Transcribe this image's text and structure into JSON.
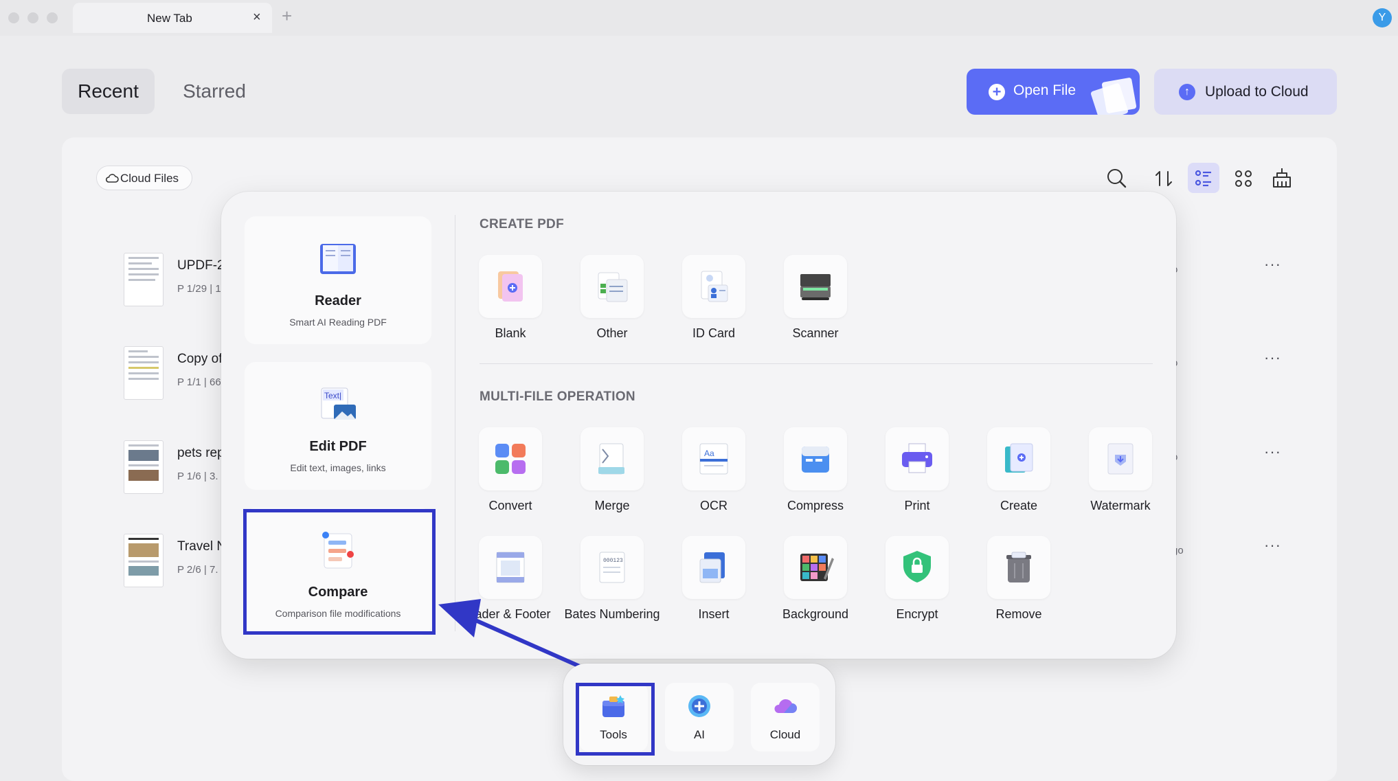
{
  "window": {
    "tab_title": "New Tab",
    "tab_close": "×",
    "new_tab": "+",
    "avatar_initial": "Y"
  },
  "header": {
    "tab_recent": "Recent",
    "tab_starred": "Starred",
    "open_file": "Open File",
    "upload": "Upload to Cloud"
  },
  "filter": {
    "cloud_files": "Cloud Files"
  },
  "files": [
    {
      "title": "UPDF-2",
      "meta": "P 1/29  |  1",
      "frag": "o"
    },
    {
      "title": "Copy of",
      "meta": "P 1/1  |  66",
      "frag": "o"
    },
    {
      "title": "pets rep",
      "meta": "P 1/6  |  3.",
      "frag": "o"
    },
    {
      "title": "Travel N",
      "meta": "P 2/6  |  7.",
      "frag": "go"
    }
  ],
  "more": "···",
  "features": [
    {
      "title": "Reader",
      "subtitle": "Smart AI Reading PDF",
      "icon": "reader-icon"
    },
    {
      "title": "Edit PDF",
      "subtitle": "Edit text, images, links",
      "icon": "edit-pdf-icon",
      "icon_text": "Text|"
    },
    {
      "title": "Compare",
      "subtitle": "Comparison file modifications",
      "icon": "compare-icon"
    }
  ],
  "create_section": {
    "heading": "CREATE PDF",
    "items": [
      "Blank",
      "Other",
      "ID Card",
      "Scanner"
    ]
  },
  "multi_section": {
    "heading": "MULTI-FILE OPERATION",
    "row1": [
      "Convert",
      "Merge",
      "OCR",
      "Compress",
      "Print",
      "Create",
      "Watermark"
    ],
    "row2": [
      "Header & Footer",
      "Bates Numbering",
      "Insert",
      "Background",
      "Encrypt",
      "Remove"
    ],
    "ocr_glyph": "Aa",
    "bates_glyph": "000123"
  },
  "dock": {
    "tools": "Tools",
    "ai": "AI",
    "cloud": "Cloud"
  },
  "colors": {
    "accent": "#5b6cf5",
    "highlight": "#3137c6",
    "panel": "#f4f4f6"
  }
}
